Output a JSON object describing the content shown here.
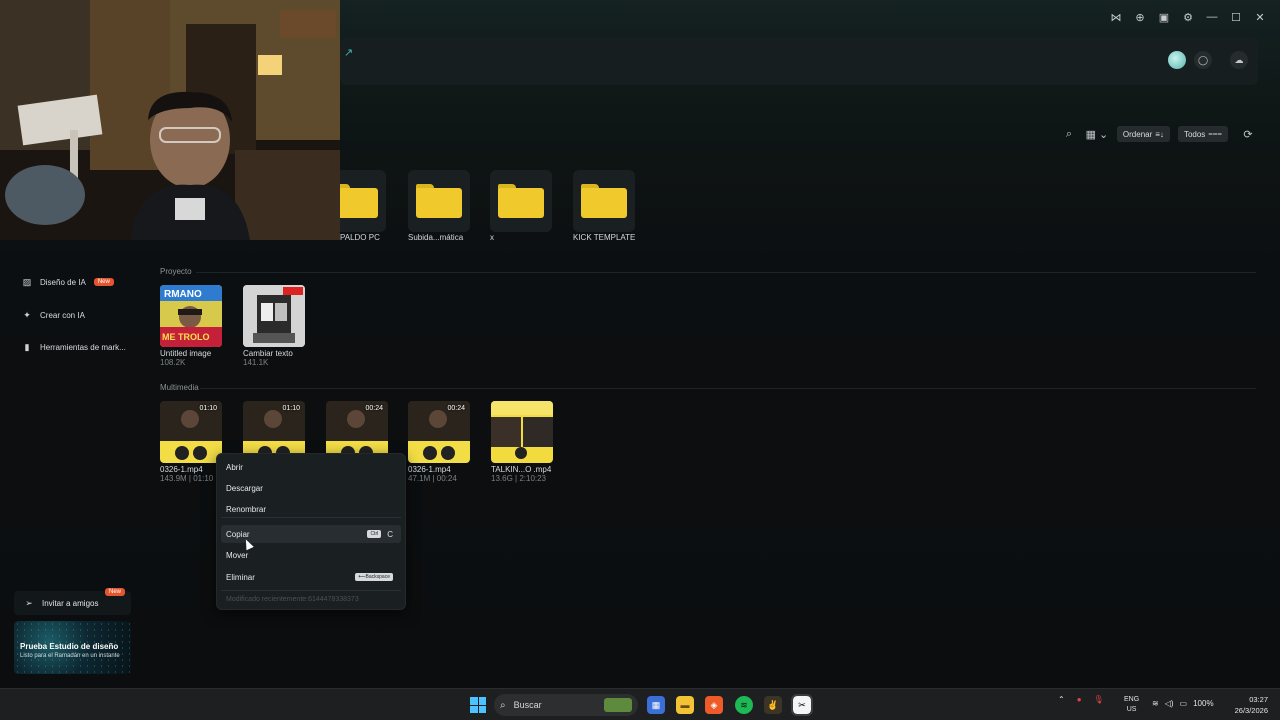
{
  "header": {
    "arrow_glyph": "↗"
  },
  "toolbar": {
    "sort_label": "Ordenar",
    "filter_label": "Todos"
  },
  "folders": [
    {
      "label": "PALDO PC"
    },
    {
      "label": "Subida...mática"
    },
    {
      "label": "x"
    },
    {
      "label": "KICK TEMPLATE"
    }
  ],
  "sidebar": {
    "items": [
      {
        "label": "Diseño de IA",
        "badge": "New",
        "icon": "ai-design-icon"
      },
      {
        "label": "Crear con IA",
        "icon": "sparkle-icon"
      },
      {
        "label": "Herramientas de mark...",
        "icon": "marketing-tools-icon"
      }
    ],
    "invite_label": "Invitar a amigos",
    "invite_badge": "New",
    "promo_title": "Prueba Estudio de diseño",
    "promo_subtitle": "Listo para el Ramadán en un instante"
  },
  "project": {
    "section_label": "Proyecto",
    "items": [
      {
        "name": "Untitled image",
        "size": "108.2K"
      },
      {
        "name": "Cambiar texto",
        "size": "141.1K"
      }
    ]
  },
  "media": {
    "section_label": "Multimedia",
    "items": [
      {
        "name": "0326-1.mp4",
        "meta": "143.9M | 01:10",
        "duration": "01:10"
      },
      {
        "name": "",
        "meta": "",
        "duration": "01:10"
      },
      {
        "name": "",
        "meta": "",
        "duration": "00:24"
      },
      {
        "name": "0326-1.mp4",
        "meta": "47.1M | 00:24",
        "duration": "00:24"
      },
      {
        "name": "TALKIN...O .mp4",
        "meta": "13.6G | 2:10:23",
        "duration": ""
      }
    ]
  },
  "context_menu": {
    "open": "Abrir",
    "download": "Descargar",
    "rename": "Renombrar",
    "copy": "Copiar",
    "copy_key_mod": "Ctrl",
    "copy_key": "C",
    "move": "Mover",
    "delete": "Eliminar",
    "delete_key": "⟵Backspace",
    "modified": "Modificado recientemente:6144478338373"
  },
  "taskbar": {
    "search_placeholder": "Buscar",
    "language": "ENG",
    "region": "US",
    "battery": "100%",
    "time": "03:27",
    "date": "26/3/2026"
  },
  "colors": {
    "folder": "#f0c92c",
    "accent": "#3fb6b0",
    "new_badge": "#e4572e",
    "windows_blue": "#4cc2ff"
  }
}
